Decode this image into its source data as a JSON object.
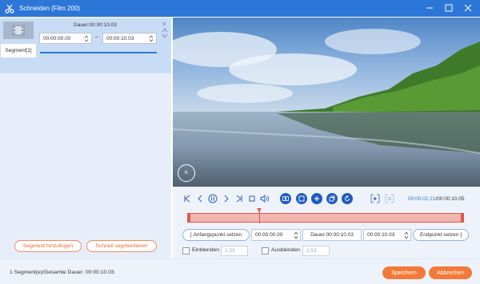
{
  "window": {
    "title": "Schneiden (Film 200)",
    "accent": "#2c76d8"
  },
  "segment": {
    "tab_label": "Segment[1]",
    "dauer": "Dauer:00:00:10.03",
    "start": "00:00:00.00",
    "end": "00:00:10.03"
  },
  "left_buttons": {
    "add_segment": "Segment hinzufügen",
    "quick_split": "Schnell segmentieren"
  },
  "player": {
    "current_time": "00:00:02.21",
    "separator": "/",
    "total_time": "00:00:10.05",
    "playhead_fraction": 0.26
  },
  "trim": {
    "set_start_label": "Anfangspunkt setzen",
    "start_value": "00:00:00.00",
    "dauer": "Dauer:00:00:10.03",
    "end_value": "00:00:10.03",
    "set_end_label": "Endpunkt setzen"
  },
  "fade": {
    "fade_in_label": "Einblenden",
    "fade_in_value": "2,53",
    "fade_out_label": "Ausblenden",
    "fade_out_value": "2,53"
  },
  "footer": {
    "summary": "1 Segment(e)/Gesamte Dauer: 00:00:10.03",
    "save_label": "Speichern",
    "cancel_label": "Abbrechen"
  },
  "icons": [
    "scissors-icon",
    "minimize-icon",
    "maximize-icon",
    "close-icon",
    "film-icon",
    "watermark-logo"
  ]
}
